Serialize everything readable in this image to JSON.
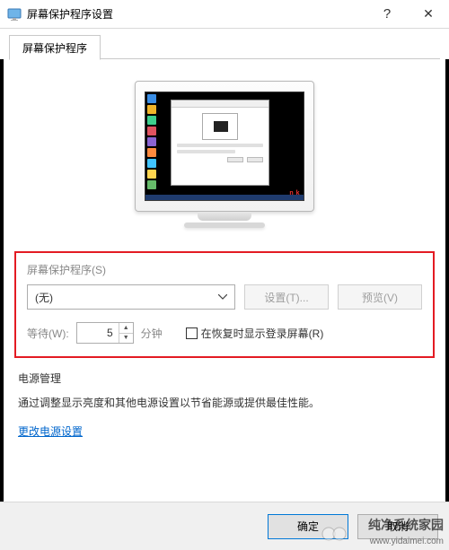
{
  "titlebar": {
    "title": "屏幕保护程序设置"
  },
  "tabs": {
    "active": "屏幕保护程序"
  },
  "section_ss": {
    "label": "屏幕保护程序(S)",
    "dropdown_value": "(无)",
    "settings_btn": "设置(T)...",
    "preview_btn": "预览(V)",
    "wait_label": "等待(W):",
    "wait_value": "5",
    "wait_unit": "分钟",
    "checkbox_label": "在恢复时显示登录屏幕(R)"
  },
  "section_power": {
    "title": "电源管理",
    "desc": "通过调整显示亮度和其他电源设置以节省能源或提供最佳性能。",
    "link": "更改电源设置"
  },
  "buttons": {
    "ok": "确定",
    "cancel": "取消"
  },
  "watermark": {
    "text": "纯净系统家园",
    "url": "www.yidaimei.com"
  }
}
